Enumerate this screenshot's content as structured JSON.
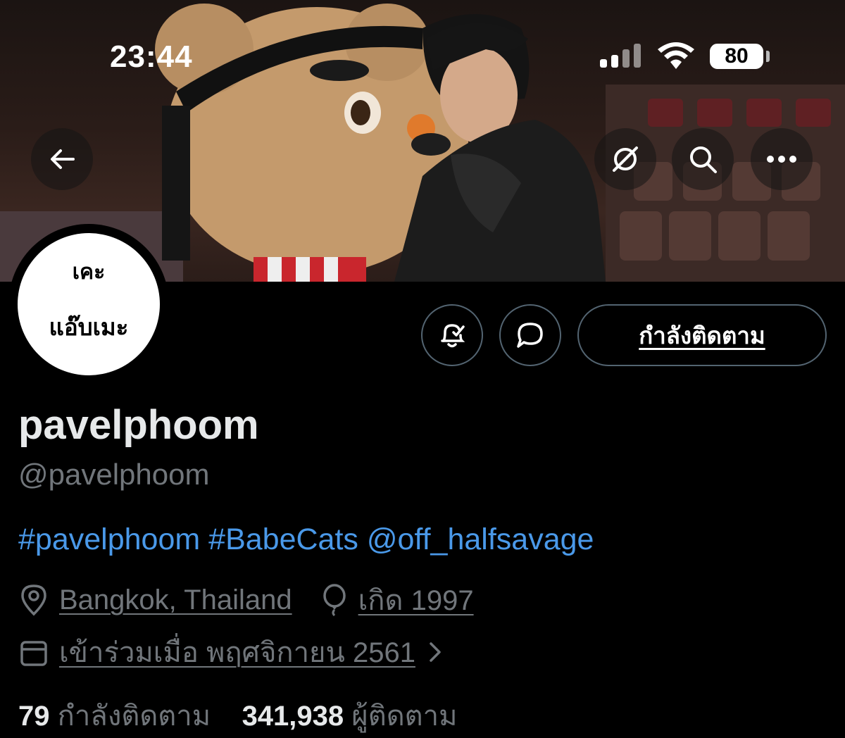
{
  "status_bar": {
    "time": "23:44",
    "battery": "80"
  },
  "profile": {
    "avatar_line1": "เคะ",
    "avatar_line2": "แอ๊บเมะ",
    "display_name": "pavelphoom",
    "handle": "@pavelphoom",
    "bio_tags": [
      "#pavelphoom",
      "#BabeCats",
      "@off_halfsavage"
    ],
    "location": "Bangkok, Thailand",
    "birth": "เกิด 1997",
    "joined": "เข้าร่วมเมื่อ พฤศจิกายน 2561",
    "following_count": "79",
    "following_label": "กำลังติดตาม",
    "followers_count": "341,938",
    "followers_label": "ผู้ติดตาม"
  },
  "actions": {
    "follow_label": "กำลังติดตาม"
  },
  "icons": [
    "back-arrow-icon",
    "hide-icon",
    "search-icon",
    "more-icon",
    "notification-bell-icon",
    "message-icon",
    "location-pin-icon",
    "balloon-icon",
    "calendar-icon",
    "chevron-right-icon"
  ],
  "colors": {
    "link": "#1d9bf0",
    "muted": "#71767b",
    "background": "#000000"
  }
}
